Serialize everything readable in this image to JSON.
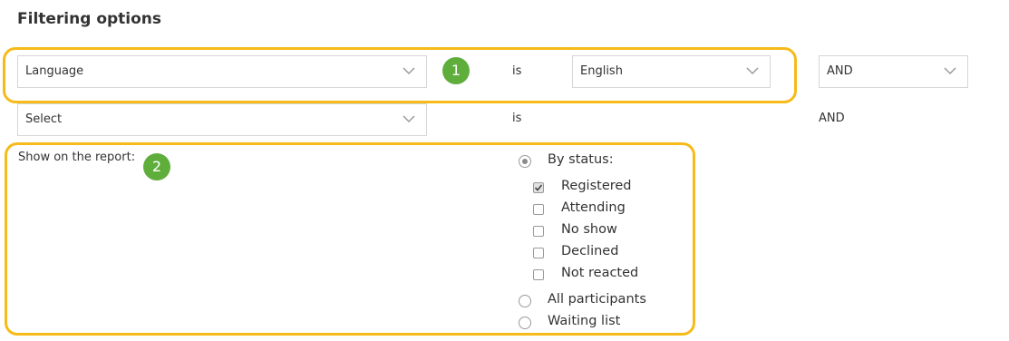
{
  "page": {
    "title": "Filtering options"
  },
  "filter_rows": [
    {
      "field": "Language",
      "operator": "is",
      "value": "English",
      "conjunction": "AND"
    },
    {
      "field": "Select",
      "operator": "is",
      "conjunction": "AND"
    }
  ],
  "report": {
    "label": "Show on the report:",
    "options": [
      {
        "label": "By status:",
        "selected": true
      },
      {
        "label": "All participants",
        "selected": false
      },
      {
        "label": "Waiting list",
        "selected": false
      }
    ],
    "statuses": [
      {
        "label": "Registered",
        "checked": true
      },
      {
        "label": "Attending",
        "checked": false
      },
      {
        "label": "No show",
        "checked": false
      },
      {
        "label": "Declined",
        "checked": false
      },
      {
        "label": "Not reacted",
        "checked": false
      }
    ]
  },
  "annotations": {
    "badge_1": "1",
    "badge_2": "2"
  },
  "colors": {
    "highlight": "#f6bb1a",
    "badge": "#5fae3c",
    "border": "#d6d6d6",
    "text": "#333333"
  },
  "icons": {
    "dropdown": "chevron-down-icon",
    "check": "checkmark-icon"
  }
}
